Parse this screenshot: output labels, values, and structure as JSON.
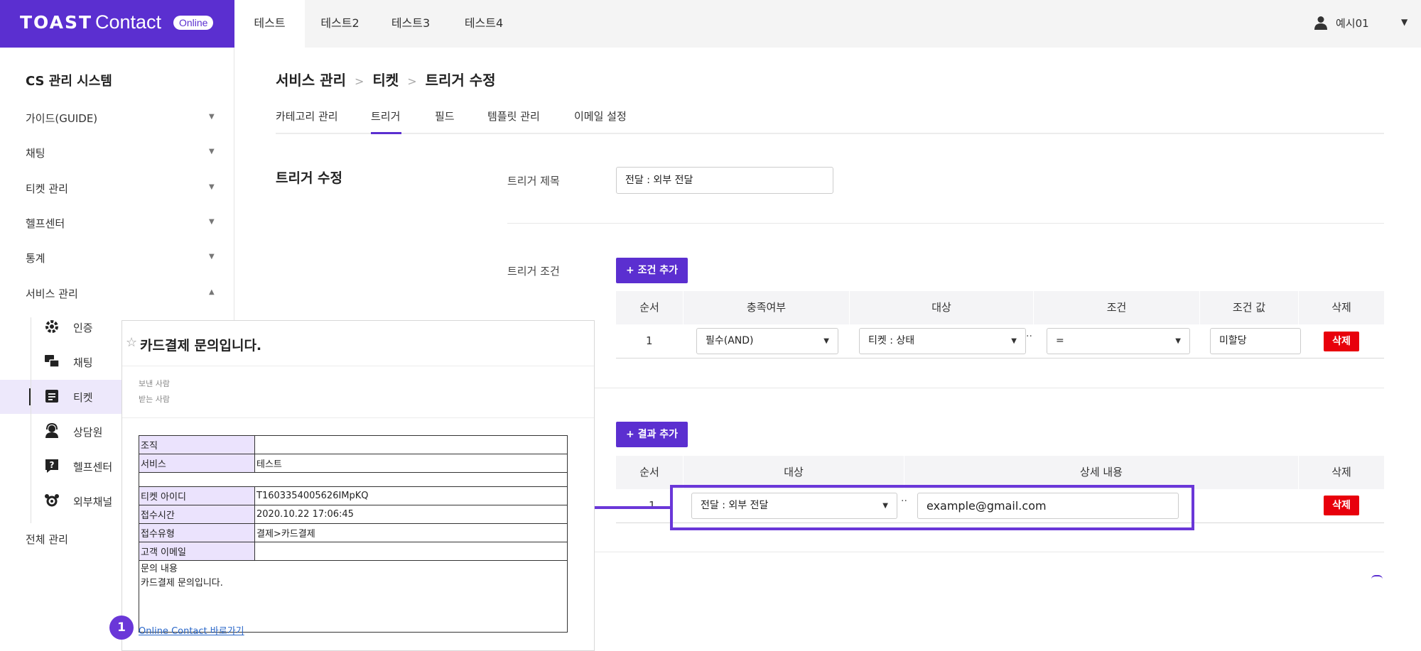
{
  "header": {
    "logo_brand": "TOAST",
    "logo_product": "Contact",
    "logo_badge": "Online",
    "tabs": [
      "테스트",
      "테스트2",
      "테스트3",
      "테스트4"
    ],
    "active_tab": 0,
    "user_name": "예시01",
    "user_icon": "user-icon"
  },
  "sidebar": {
    "title": "CS 관리 시스템",
    "menus": [
      "가이드(GUIDE)",
      "채팅",
      "티켓 관리",
      "헬프센터",
      "통계",
      "서비스 관리"
    ],
    "sub_items": [
      {
        "label": "인증",
        "icon": "gear-icon"
      },
      {
        "label": "채팅",
        "icon": "chat-icon"
      },
      {
        "label": "티켓",
        "icon": "ticket-icon"
      },
      {
        "label": "상담원",
        "icon": "agent-icon"
      },
      {
        "label": "헬프센터",
        "icon": "help-icon"
      },
      {
        "label": "외부채널",
        "icon": "external-channel-icon"
      }
    ],
    "active_sub": 2,
    "bottom_menu": "전체 관리"
  },
  "breadcrumb": [
    "서비스 관리",
    "티켓",
    "트리거 수정"
  ],
  "sub_tabs": [
    "카테고리 관리",
    "트리거",
    "필드",
    "템플릿 관리",
    "이메일 설정"
  ],
  "active_sub_tab": 1,
  "form": {
    "section_title": "트리거 수정",
    "title_label": "트리거 제목",
    "title_value": "전달 : 외부 전달",
    "condition_label": "트리거 조건",
    "add_condition_label": "+ 조건 추가",
    "condition_headers": [
      "순서",
      "충족여부",
      "대상",
      "조건",
      "조건 값",
      "삭제"
    ],
    "condition_row": {
      "order": "1",
      "fulfill": "필수(AND)",
      "target": "티켓 : 상태",
      "operator": "=",
      "value": "미할당",
      "delete": "삭제"
    },
    "add_result_label": "+ 결과 추가",
    "result_headers": [
      "순서",
      "대상",
      "상세 내용",
      "삭제"
    ],
    "result_row": {
      "order": "1",
      "target": "전달 : 외부 전달",
      "detail": "example@gmail.com",
      "delete": "삭제"
    }
  },
  "email": {
    "subject": "카드결제 문의입니다.",
    "from_label": "보낸 사람",
    "to_label": "받는 사람",
    "rows": [
      {
        "label": "조직",
        "value": ""
      },
      {
        "label": "서비스",
        "value": "테스트"
      },
      {
        "label": "",
        "value": ""
      },
      {
        "label": "티켓 아이디",
        "value": "T1603354005626IMpKQ"
      },
      {
        "label": "접수시간",
        "value": "2020.10.22 17:06:45"
      },
      {
        "label": "접수유형",
        "value": "결제>카드결제"
      },
      {
        "label": "고객 이메일",
        "value": ""
      }
    ],
    "content_label": "문의 내용",
    "content_text": "카드결제 문의입니다.",
    "link_text": "Online Contact 바로가기"
  },
  "step_badge": "1",
  "colors": {
    "brand": "#5b2fd0",
    "accent": "#6a37d8",
    "delete": "#e8000c",
    "active_row": "#ede8fb",
    "email_label_bg": "#ebe3fd"
  }
}
